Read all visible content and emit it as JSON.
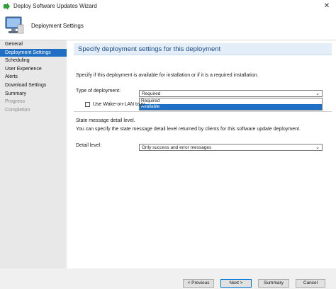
{
  "window": {
    "title": "Deploy Software Updates Wizard",
    "close_glyph": "✕"
  },
  "header": {
    "step_title": "Deployment Settings"
  },
  "sidebar": {
    "items": [
      {
        "label": "General",
        "state": "normal"
      },
      {
        "label": "Deployment Settings",
        "state": "active"
      },
      {
        "label": "Scheduling",
        "state": "normal"
      },
      {
        "label": "User Experience",
        "state": "normal"
      },
      {
        "label": "Alerts",
        "state": "normal"
      },
      {
        "label": "Download Settings",
        "state": "normal"
      },
      {
        "label": "Summary",
        "state": "normal"
      },
      {
        "label": "Progress",
        "state": "disabled"
      },
      {
        "label": "Completion",
        "state": "disabled"
      }
    ]
  },
  "main": {
    "banner_title": "Specify deployment settings for this deployment",
    "intro": "Specify if this deployment is available for installation or if it is a required installation.",
    "type_label": "Type of deployment:",
    "type_value": "Required",
    "type_options": [
      "Required",
      "Available"
    ],
    "type_highlighted": "Available",
    "wol_label": "Use Wake-on-LAN to w",
    "state_heading": "State message detail level.",
    "state_desc": "You can specify the state message detail level returned by clients for this software update deployment.",
    "detail_label": "Detail level:",
    "detail_value": "Only success and error messages"
  },
  "footer": {
    "previous": "< Previous",
    "next": "Next >",
    "summary": "Summary",
    "cancel": "Cancel"
  },
  "colors": {
    "accent": "#1f6fc5",
    "banner_text": "#1a4a87",
    "banner_bg": "#e4eef8",
    "sidebar_bg": "#e8e8e8"
  },
  "icons": {
    "app": "sccm-arrow-icon",
    "header": "computer-monitor-icon",
    "brand": "brand-logo-icon",
    "combo": "chevron-down-icon"
  }
}
